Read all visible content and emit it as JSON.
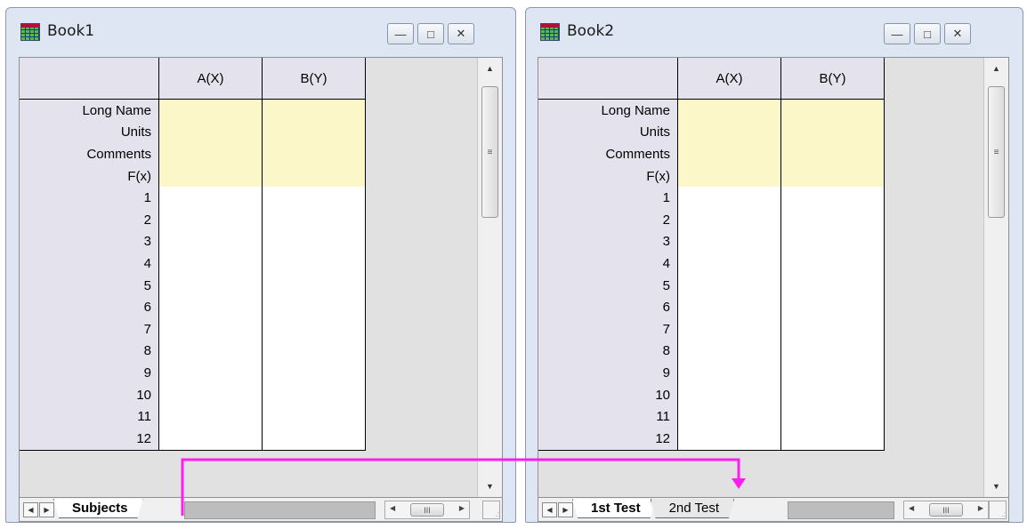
{
  "book1": {
    "title": "Book1",
    "columns": [
      "A(X)",
      "B(Y)"
    ],
    "label_rows": [
      "Long Name",
      "Units",
      "Comments",
      "F(x)"
    ],
    "rows": [
      "1",
      "2",
      "3",
      "4",
      "5",
      "6",
      "7",
      "8",
      "9",
      "10",
      "11",
      "12"
    ],
    "tabs": [
      "Subjects"
    ]
  },
  "book2": {
    "title": "Book2",
    "columns": [
      "A(X)",
      "B(Y)"
    ],
    "label_rows": [
      "Long Name",
      "Units",
      "Comments",
      "F(x)"
    ],
    "rows": [
      "1",
      "2",
      "3",
      "4",
      "5",
      "6",
      "7",
      "8",
      "9",
      "10",
      "11",
      "12"
    ],
    "tabs": [
      "1st Test",
      "2nd Test"
    ]
  },
  "icons": {
    "minimize": "minimize-icon",
    "maximize": "maximize-icon",
    "close": "close-icon",
    "annotation_arrow": "arrow-connector-icon"
  },
  "colors": {
    "annotation": "#ff1cf0",
    "label_row_fill": "#fbf7c8",
    "header_fill": "#e4e2ec"
  }
}
